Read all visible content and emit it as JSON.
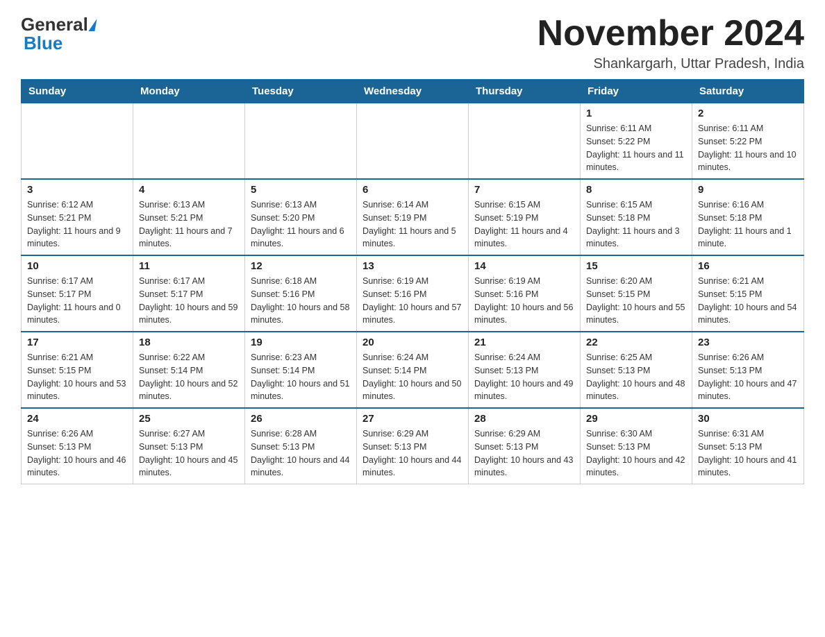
{
  "header": {
    "logo_general": "General",
    "logo_blue": "Blue",
    "month_title": "November 2024",
    "location": "Shankargarh, Uttar Pradesh, India"
  },
  "weekdays": [
    "Sunday",
    "Monday",
    "Tuesday",
    "Wednesday",
    "Thursday",
    "Friday",
    "Saturday"
  ],
  "weeks": [
    [
      {
        "day": "",
        "sunrise": "",
        "sunset": "",
        "daylight": ""
      },
      {
        "day": "",
        "sunrise": "",
        "sunset": "",
        "daylight": ""
      },
      {
        "day": "",
        "sunrise": "",
        "sunset": "",
        "daylight": ""
      },
      {
        "day": "",
        "sunrise": "",
        "sunset": "",
        "daylight": ""
      },
      {
        "day": "",
        "sunrise": "",
        "sunset": "",
        "daylight": ""
      },
      {
        "day": "1",
        "sunrise": "Sunrise: 6:11 AM",
        "sunset": "Sunset: 5:22 PM",
        "daylight": "Daylight: 11 hours and 11 minutes."
      },
      {
        "day": "2",
        "sunrise": "Sunrise: 6:11 AM",
        "sunset": "Sunset: 5:22 PM",
        "daylight": "Daylight: 11 hours and 10 minutes."
      }
    ],
    [
      {
        "day": "3",
        "sunrise": "Sunrise: 6:12 AM",
        "sunset": "Sunset: 5:21 PM",
        "daylight": "Daylight: 11 hours and 9 minutes."
      },
      {
        "day": "4",
        "sunrise": "Sunrise: 6:13 AM",
        "sunset": "Sunset: 5:21 PM",
        "daylight": "Daylight: 11 hours and 7 minutes."
      },
      {
        "day": "5",
        "sunrise": "Sunrise: 6:13 AM",
        "sunset": "Sunset: 5:20 PM",
        "daylight": "Daylight: 11 hours and 6 minutes."
      },
      {
        "day": "6",
        "sunrise": "Sunrise: 6:14 AM",
        "sunset": "Sunset: 5:19 PM",
        "daylight": "Daylight: 11 hours and 5 minutes."
      },
      {
        "day": "7",
        "sunrise": "Sunrise: 6:15 AM",
        "sunset": "Sunset: 5:19 PM",
        "daylight": "Daylight: 11 hours and 4 minutes."
      },
      {
        "day": "8",
        "sunrise": "Sunrise: 6:15 AM",
        "sunset": "Sunset: 5:18 PM",
        "daylight": "Daylight: 11 hours and 3 minutes."
      },
      {
        "day": "9",
        "sunrise": "Sunrise: 6:16 AM",
        "sunset": "Sunset: 5:18 PM",
        "daylight": "Daylight: 11 hours and 1 minute."
      }
    ],
    [
      {
        "day": "10",
        "sunrise": "Sunrise: 6:17 AM",
        "sunset": "Sunset: 5:17 PM",
        "daylight": "Daylight: 11 hours and 0 minutes."
      },
      {
        "day": "11",
        "sunrise": "Sunrise: 6:17 AM",
        "sunset": "Sunset: 5:17 PM",
        "daylight": "Daylight: 10 hours and 59 minutes."
      },
      {
        "day": "12",
        "sunrise": "Sunrise: 6:18 AM",
        "sunset": "Sunset: 5:16 PM",
        "daylight": "Daylight: 10 hours and 58 minutes."
      },
      {
        "day": "13",
        "sunrise": "Sunrise: 6:19 AM",
        "sunset": "Sunset: 5:16 PM",
        "daylight": "Daylight: 10 hours and 57 minutes."
      },
      {
        "day": "14",
        "sunrise": "Sunrise: 6:19 AM",
        "sunset": "Sunset: 5:16 PM",
        "daylight": "Daylight: 10 hours and 56 minutes."
      },
      {
        "day": "15",
        "sunrise": "Sunrise: 6:20 AM",
        "sunset": "Sunset: 5:15 PM",
        "daylight": "Daylight: 10 hours and 55 minutes."
      },
      {
        "day": "16",
        "sunrise": "Sunrise: 6:21 AM",
        "sunset": "Sunset: 5:15 PM",
        "daylight": "Daylight: 10 hours and 54 minutes."
      }
    ],
    [
      {
        "day": "17",
        "sunrise": "Sunrise: 6:21 AM",
        "sunset": "Sunset: 5:15 PM",
        "daylight": "Daylight: 10 hours and 53 minutes."
      },
      {
        "day": "18",
        "sunrise": "Sunrise: 6:22 AM",
        "sunset": "Sunset: 5:14 PM",
        "daylight": "Daylight: 10 hours and 52 minutes."
      },
      {
        "day": "19",
        "sunrise": "Sunrise: 6:23 AM",
        "sunset": "Sunset: 5:14 PM",
        "daylight": "Daylight: 10 hours and 51 minutes."
      },
      {
        "day": "20",
        "sunrise": "Sunrise: 6:24 AM",
        "sunset": "Sunset: 5:14 PM",
        "daylight": "Daylight: 10 hours and 50 minutes."
      },
      {
        "day": "21",
        "sunrise": "Sunrise: 6:24 AM",
        "sunset": "Sunset: 5:13 PM",
        "daylight": "Daylight: 10 hours and 49 minutes."
      },
      {
        "day": "22",
        "sunrise": "Sunrise: 6:25 AM",
        "sunset": "Sunset: 5:13 PM",
        "daylight": "Daylight: 10 hours and 48 minutes."
      },
      {
        "day": "23",
        "sunrise": "Sunrise: 6:26 AM",
        "sunset": "Sunset: 5:13 PM",
        "daylight": "Daylight: 10 hours and 47 minutes."
      }
    ],
    [
      {
        "day": "24",
        "sunrise": "Sunrise: 6:26 AM",
        "sunset": "Sunset: 5:13 PM",
        "daylight": "Daylight: 10 hours and 46 minutes."
      },
      {
        "day": "25",
        "sunrise": "Sunrise: 6:27 AM",
        "sunset": "Sunset: 5:13 PM",
        "daylight": "Daylight: 10 hours and 45 minutes."
      },
      {
        "day": "26",
        "sunrise": "Sunrise: 6:28 AM",
        "sunset": "Sunset: 5:13 PM",
        "daylight": "Daylight: 10 hours and 44 minutes."
      },
      {
        "day": "27",
        "sunrise": "Sunrise: 6:29 AM",
        "sunset": "Sunset: 5:13 PM",
        "daylight": "Daylight: 10 hours and 44 minutes."
      },
      {
        "day": "28",
        "sunrise": "Sunrise: 6:29 AM",
        "sunset": "Sunset: 5:13 PM",
        "daylight": "Daylight: 10 hours and 43 minutes."
      },
      {
        "day": "29",
        "sunrise": "Sunrise: 6:30 AM",
        "sunset": "Sunset: 5:13 PM",
        "daylight": "Daylight: 10 hours and 42 minutes."
      },
      {
        "day": "30",
        "sunrise": "Sunrise: 6:31 AM",
        "sunset": "Sunset: 5:13 PM",
        "daylight": "Daylight: 10 hours and 41 minutes."
      }
    ]
  ]
}
